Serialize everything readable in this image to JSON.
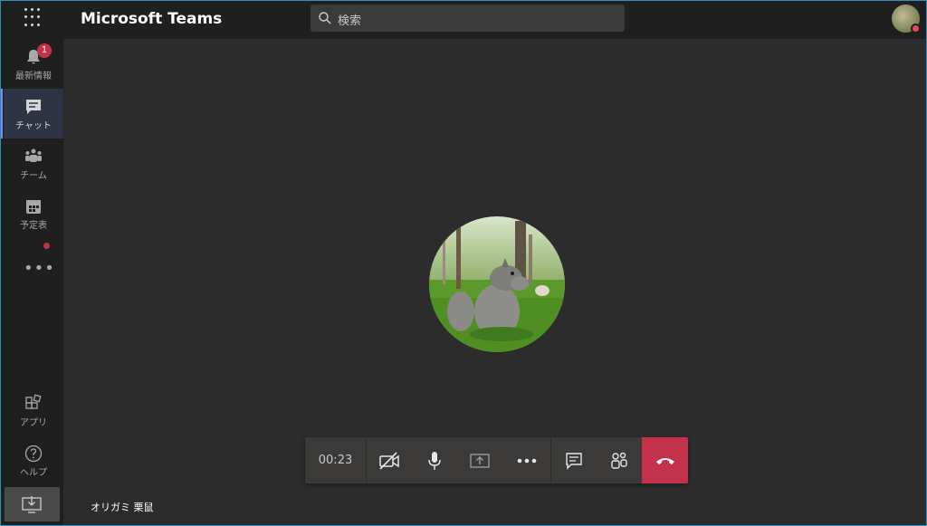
{
  "app": {
    "title": "Microsoft Teams"
  },
  "search": {
    "placeholder": "検索"
  },
  "rail": {
    "items": [
      {
        "label": "最新情報",
        "icon": "bell-icon",
        "badge": "1"
      },
      {
        "label": "チャット",
        "icon": "chat-icon",
        "active": true
      },
      {
        "label": "チーム",
        "icon": "teams-icon"
      },
      {
        "label": "予定表",
        "icon": "calendar-icon"
      },
      {
        "label": "アプリ",
        "icon": "apps-icon"
      },
      {
        "label": "ヘルプ",
        "icon": "help-icon"
      }
    ],
    "more": "•••"
  },
  "call": {
    "timer": "00:23",
    "participant_name": "オリガミ 栗鼠",
    "controls": [
      "camera-off-icon",
      "microphone-icon",
      "share-screen-icon",
      "more-icon",
      "chat-icon",
      "participants-icon",
      "hang-up-icon"
    ]
  },
  "colors": {
    "accent": "#7f85f5",
    "hangup": "#c4314b",
    "background": "#2d2c2c",
    "chrome": "#1f1f1f"
  }
}
